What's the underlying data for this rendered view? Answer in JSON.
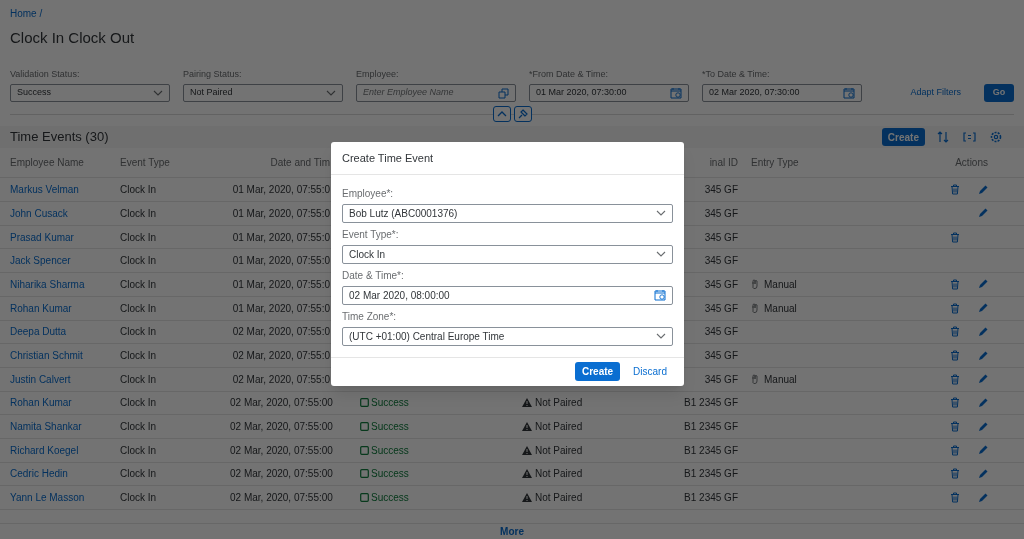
{
  "breadcrumb": "Home /",
  "title": "Clock In Clock Out",
  "filters": [
    {
      "label": "Validation Status:",
      "kind": "select",
      "value": "Success"
    },
    {
      "label": "Pairing Status:",
      "kind": "select",
      "value": "Not Paired"
    },
    {
      "label": "Employee:",
      "kind": "help",
      "placeholder": "Enter Employee Name"
    },
    {
      "label": "*From Date & Time:",
      "kind": "date",
      "value": "01 Mar 2020, 07:30:00"
    },
    {
      "label": "*To Date & Time:",
      "kind": "date",
      "value": "02 Mar 2020, 07:30:00"
    }
  ],
  "adapt_filters": "Adapt Filters",
  "go": "Go",
  "table": {
    "title": "Time Events (30)",
    "create": "Create",
    "columns": [
      "Employee Name",
      "Event Type",
      "Date and Tim",
      "inal ID",
      "Entry Type",
      "Actions"
    ],
    "rows": [
      {
        "name": "Markus Velman",
        "event_type": "Clock In",
        "date": "01 Mar, 2020, 07:55:0",
        "terminal": "345 GF",
        "delete": true,
        "edit": true
      },
      {
        "name": "John Cusack",
        "event_type": "Clock In",
        "date": "01 Mar, 2020, 07:55:0",
        "terminal": "345 GF",
        "delete": false,
        "edit": true
      },
      {
        "name": "Prasad Kumar",
        "event_type": "Clock In",
        "date": "01 Mar, 2020, 07:55:0",
        "terminal": "345 GF",
        "delete": true,
        "edit": false
      },
      {
        "name": "Jack Spencer",
        "event_type": "Clock In",
        "date": "01 Mar, 2020, 07:55:0",
        "terminal": "345 GF",
        "delete": false,
        "edit": false
      },
      {
        "name": "Niharika Sharma",
        "event_type": "Clock In",
        "date": "01 Mar, 2020, 07:55:0",
        "terminal": "345 GF",
        "entry_type": "Manual",
        "delete": true,
        "edit": true
      },
      {
        "name": "Rohan Kumar",
        "event_type": "Clock In",
        "date": "01 Mar, 2020, 07:55:0",
        "terminal": "345 GF",
        "entry_type": "Manual",
        "delete": true,
        "edit": true
      },
      {
        "name": "Deepa Dutta",
        "event_type": "Clock In",
        "date": "02 Mar, 2020, 07:55:0",
        "terminal": "345 GF",
        "delete": true,
        "edit": true
      },
      {
        "name": "Christian Schmit",
        "event_type": "Clock In",
        "date": "02 Mar, 2020, 07:55:0",
        "terminal": "345 GF",
        "delete": true,
        "edit": true
      },
      {
        "name": "Justin Calvert",
        "event_type": "Clock In",
        "date": "02 Mar, 2020, 07:55:0",
        "terminal": "345 GF",
        "entry_type": "Manual",
        "delete": true,
        "edit": true
      },
      {
        "name": "Rohan Kumar",
        "event_type": "Clock In",
        "date": "02 Mar, 2020, 07:55:00",
        "validation": "Success",
        "pairing": "Not Paired",
        "terminal": "B1 2345 GF",
        "delete": true,
        "edit": true
      },
      {
        "name": "Namita Shankar",
        "event_type": "Clock In",
        "date": "02 Mar, 2020, 07:55:00",
        "validation": "Success",
        "pairing": "Not Paired",
        "terminal": "B1 2345 GF",
        "delete": true,
        "edit": true
      },
      {
        "name": "Richard Koegel",
        "event_type": "Clock In",
        "date": "02 Mar, 2020, 07:55:00",
        "validation": "Success",
        "pairing": "Not Paired",
        "terminal": "B1 2345 GF",
        "delete": true,
        "edit": true
      },
      {
        "name": "Cedric Hedin",
        "event_type": "Clock In",
        "date": "02 Mar, 2020, 07:55:00",
        "validation": "Success",
        "pairing": "Not Paired",
        "terminal": "B1 2345 GF",
        "delete": true,
        "edit": true
      },
      {
        "name": "Yann Le Masson",
        "event_type": "Clock In",
        "date": "02 Mar, 2020, 07:55:00",
        "validation": "Success",
        "pairing": "Not Paired",
        "terminal": "B1 2345 GF",
        "delete": true,
        "edit": true
      }
    ],
    "more": "More"
  },
  "dialog": {
    "title": "Create Time Event",
    "fields": [
      {
        "label": "Employee*:",
        "kind": "select",
        "value": "Bob Lutz (ABC0001376)"
      },
      {
        "label": "Event Type*:",
        "kind": "select",
        "value": "Clock In"
      },
      {
        "label": "Date & Time*:",
        "kind": "date",
        "value": "02 Mar 2020, 08:00:00"
      },
      {
        "label": "Time Zone*:",
        "kind": "select",
        "value": "(UTC +01:00) Central Europe Time"
      }
    ],
    "buttons": [
      {
        "label": "Create",
        "kind": "primary"
      },
      {
        "label": "Discard",
        "kind": "link"
      }
    ]
  }
}
